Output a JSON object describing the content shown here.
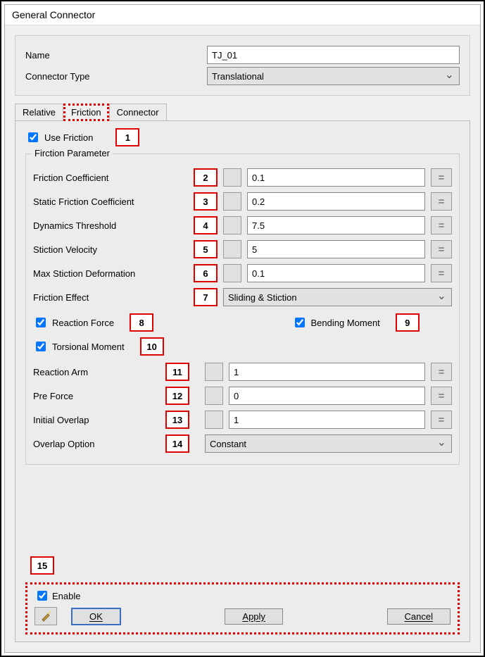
{
  "window": {
    "title": "General Connector"
  },
  "header": {
    "name_label": "Name",
    "name_value": "TJ_01",
    "type_label": "Connector Type",
    "type_value": "Translational"
  },
  "tabs": {
    "relative": "Relative",
    "friction": "Friction",
    "connector": "Connector"
  },
  "useFriction": {
    "label": "Use Friction",
    "callout": "1"
  },
  "fieldset": {
    "legend": "Firction Parameter"
  },
  "params": {
    "fc": {
      "label": "Friction Coefficient",
      "callout": "2",
      "value": "0.1"
    },
    "sfc": {
      "label": "Static Friction Coefficient",
      "callout": "3",
      "value": "0.2"
    },
    "dt": {
      "label": "Dynamics Threshold",
      "callout": "4",
      "value": "7.5"
    },
    "sv": {
      "label": "Stiction Velocity",
      "callout": "5",
      "value": "5"
    },
    "msd": {
      "label": "Max Stiction Deformation",
      "callout": "6",
      "value": "0.1"
    },
    "fe": {
      "label": "Friction Effect",
      "callout": "7",
      "value": "Sliding & Stiction"
    }
  },
  "checks": {
    "rf": {
      "label": "Reaction Force",
      "callout": "8"
    },
    "bm": {
      "label": "Bending Moment",
      "callout": "9"
    },
    "tm": {
      "label": "Torsional Moment",
      "callout": "10"
    }
  },
  "params2": {
    "ra": {
      "label": "Reaction Arm",
      "callout": "11",
      "value": "1"
    },
    "pf": {
      "label": "Pre Force",
      "callout": "12",
      "value": "0"
    },
    "io": {
      "label": "Initial Overlap",
      "callout": "13",
      "value": "1"
    },
    "oo": {
      "label": "Overlap Option",
      "callout": "14",
      "value": "Constant"
    }
  },
  "footer": {
    "callout": "15",
    "enable": "Enable",
    "ok": "OK",
    "apply": "Apply",
    "cancel": "Cancel"
  },
  "eq": "="
}
